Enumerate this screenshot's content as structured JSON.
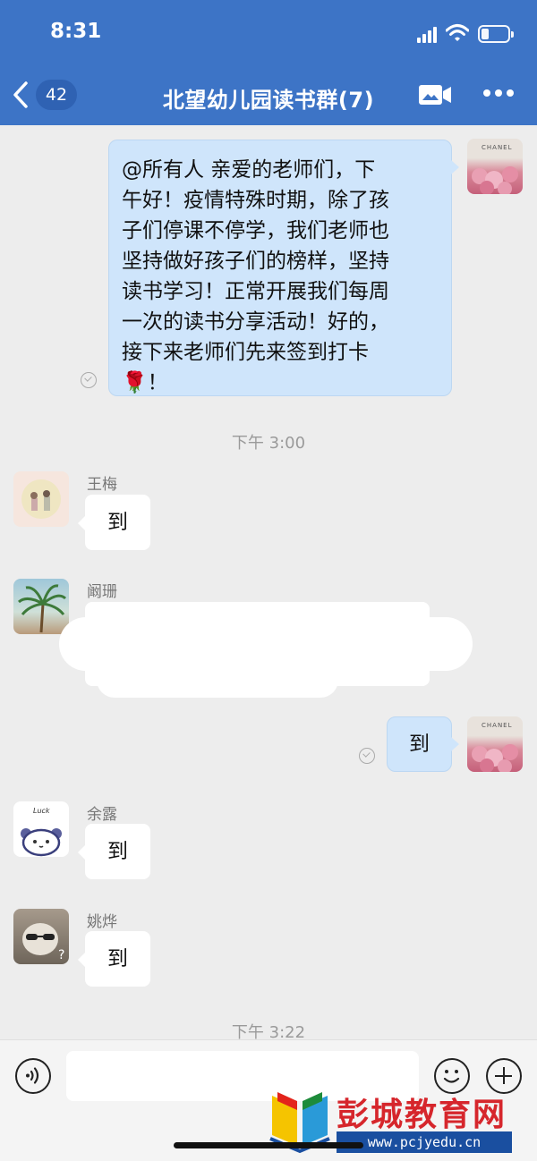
{
  "status_bar": {
    "time": "8:31"
  },
  "header": {
    "unread_count": "42",
    "title": "北望幼儿园读书群(7)"
  },
  "messages": [
    {
      "type": "outgoing",
      "text": "@所有人 亲爱的老师们，下\n午好！疫情特殊时期，除了孩\n子们停课不停学，我们老师也\n坚持做好孩子们的榜样，坚持\n读书学习！正常开展我们每周\n一次的读书分享活动！好的，\n接下来老师们先来签到打卡\n🌹！"
    },
    {
      "type": "time",
      "text": "下午 3:00"
    },
    {
      "type": "incoming",
      "sender": "王梅",
      "text": "到"
    },
    {
      "type": "incoming",
      "sender": "阚珊",
      "text": ""
    },
    {
      "type": "outgoing",
      "text": "到"
    },
    {
      "type": "incoming",
      "sender": "余露",
      "text": "到"
    },
    {
      "type": "incoming",
      "sender": "姚烨",
      "text": "到"
    },
    {
      "type": "time",
      "text": "下午 3:22"
    }
  ],
  "avatar_text": {
    "self": "CHANEL",
    "yulu": "Luck"
  },
  "input": {
    "placeholder": ""
  },
  "watermark": {
    "title": "彭城教育网",
    "url": "www.pcjyedu.cn"
  },
  "colors": {
    "header": "#3d74c6",
    "outgoing_bubble": "#cfe5fb",
    "background": "#ededed"
  }
}
